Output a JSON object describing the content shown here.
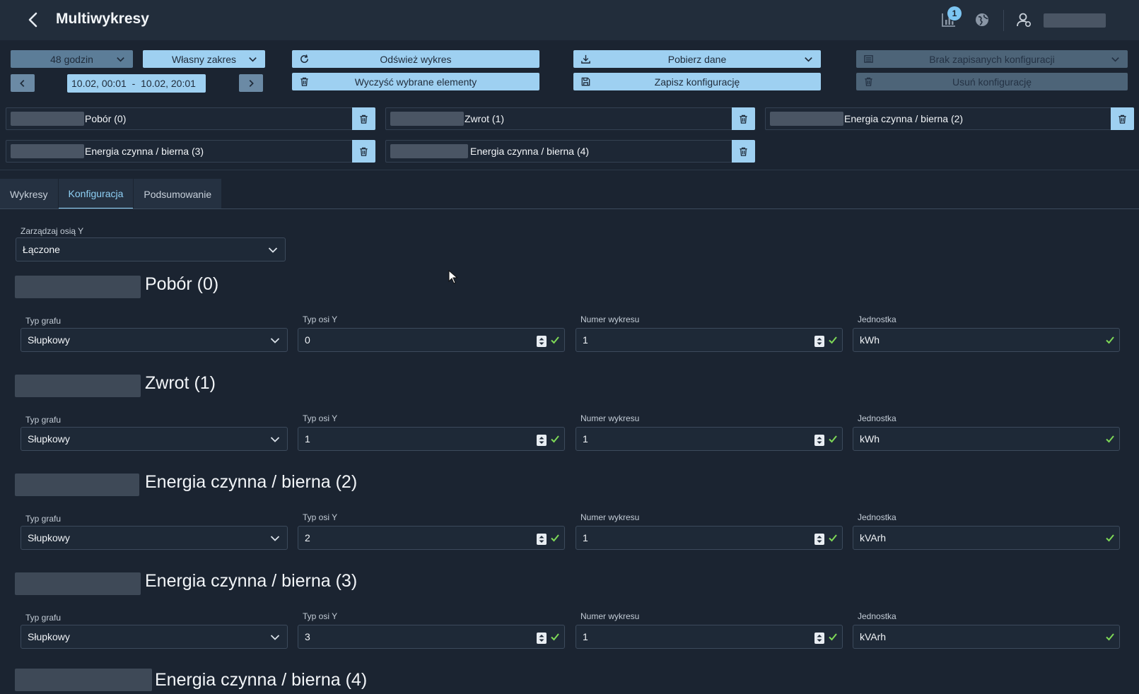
{
  "header": {
    "title": "Multiwykresy",
    "notification_count": "1"
  },
  "toolbar": {
    "period_select": "48 godzin",
    "range_select": "Własny zakres",
    "date_range": "10.02, 00:01  -  10.02, 20:01",
    "refresh_label": "Odśwież wykres",
    "clear_label": "Wyczyść wybrane elementy",
    "download_label": "Pobierz dane",
    "save_config_label": "Zapisz konfigurację",
    "saved_configs_label": "Brak zapisanych konfiguracji",
    "delete_config_label": "Usuń konfigurację"
  },
  "chips": [
    {
      "label": "Pobór (0)"
    },
    {
      "label": "Zwrot (1)"
    },
    {
      "label": "Energia czynna / bierna (2)"
    },
    {
      "label": "Energia czynna / bierna (3)"
    },
    {
      "label": "Energia czynna / bierna (4)"
    }
  ],
  "tabs": [
    {
      "label": "Wykresy"
    },
    {
      "label": "Konfiguracja"
    },
    {
      "label": "Podsumowanie"
    }
  ],
  "config": {
    "y_axis_label": "Zarządzaj osią Y",
    "y_axis_value": "Łączone",
    "field_labels": {
      "graph_type": "Typ grafu",
      "y_axis_type": "Typ osi Y",
      "chart_number": "Numer wykresu",
      "unit": "Jednostka"
    },
    "sections": [
      {
        "title": "Pobór (0)",
        "graph_type": "Słupkowy",
        "y_axis_type": "0",
        "chart_number": "1",
        "unit": "kWh"
      },
      {
        "title": "Zwrot (1)",
        "graph_type": "Słupkowy",
        "y_axis_type": "1",
        "chart_number": "1",
        "unit": "kWh"
      },
      {
        "title": "Energia czynna / bierna (2)",
        "graph_type": "Słupkowy",
        "y_axis_type": "2",
        "chart_number": "1",
        "unit": "kVArh"
      },
      {
        "title": "Energia czynna / bierna (3)",
        "graph_type": "Słupkowy",
        "y_axis_type": "3",
        "chart_number": "1",
        "unit": "kVArh"
      },
      {
        "title": "Energia czynna / bierna (4)"
      }
    ]
  },
  "colors": {
    "accent": "#9ed0f1",
    "background": "#1b2431",
    "check_green": "#7ed957"
  }
}
